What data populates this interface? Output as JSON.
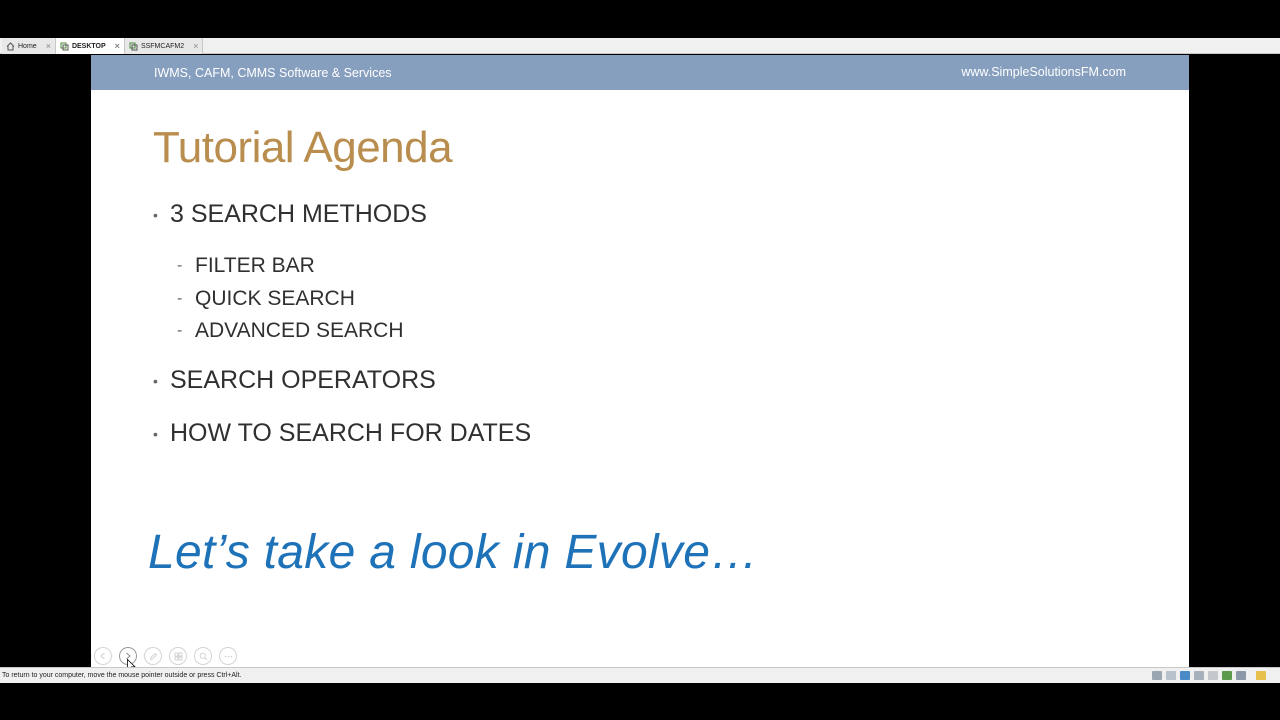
{
  "tabs": [
    {
      "label": "Home",
      "icon": "home-icon",
      "active": false
    },
    {
      "label": "DESKTOP",
      "icon": "remote-desktop-icon",
      "active": true
    },
    {
      "label": "SSFMCAFM2",
      "icon": "remote-desktop-icon",
      "active": false
    }
  ],
  "slide": {
    "header_left": "IWMS, CAFM, CMMS Software & Services",
    "header_right": "www.SimpleSolutionsFM.com",
    "title": "Tutorial Agenda",
    "bullets": [
      {
        "text": "3 SEARCH METHODS"
      },
      {
        "text": "SEARCH OPERATORS"
      },
      {
        "text": "HOW TO SEARCH FOR DATES"
      }
    ],
    "sub_items": [
      "FILTER BAR",
      "QUICK SEARCH",
      "ADVANCED SEARCH"
    ],
    "cta": "Let’s take a look in Evolve…",
    "bullet_glyph": "•",
    "sub_glyph": "-"
  },
  "controls": [
    "previous-slide",
    "next-slide",
    "pen",
    "slides-overview",
    "zoom",
    "more-options"
  ],
  "status": {
    "message": "To return to your computer, move the mouse pointer outside or press Ctrl+Alt."
  },
  "colors": {
    "header_band": "#879fbf",
    "title": "#b88d4e",
    "cta": "#1d72b8",
    "body_text": "#303030"
  }
}
